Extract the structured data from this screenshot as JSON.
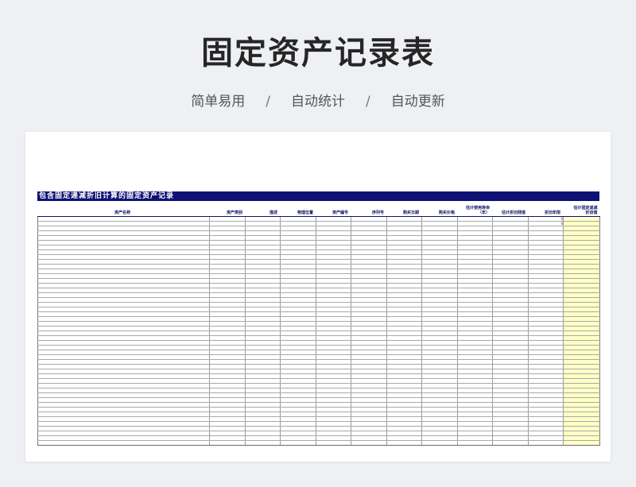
{
  "header": {
    "title": "固定资产记录表",
    "features": [
      "简单易用",
      "自动统计",
      "自动更新"
    ],
    "separator": "/"
  },
  "sheet": {
    "title": "包含固定递减折旧计算的固定资产记录",
    "columns": [
      "资产名称",
      "资产类别",
      "描述",
      "物理位置",
      "资产编号",
      "序列号",
      "购买日期",
      "购买价格",
      "估计使用寿命\n（年）",
      "估计折旧残值",
      "折旧年限",
      "估计固定递减\n折旧值"
    ],
    "first_row_markers": [
      "0",
      "0"
    ],
    "row_count": 48,
    "highlight_color": "#ffffc6",
    "header_color": "#0d1173"
  }
}
